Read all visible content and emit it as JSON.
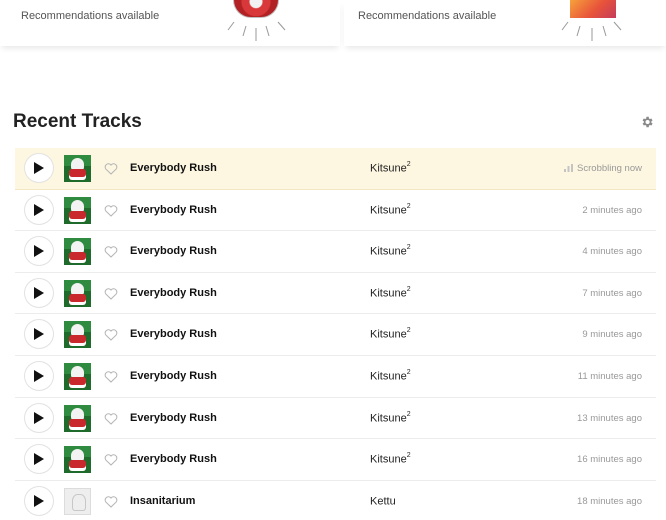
{
  "recommendations": {
    "cards": [
      {
        "text": "Recommendations available"
      },
      {
        "text": "Recommendations available"
      }
    ]
  },
  "section": {
    "title": "Recent Tracks",
    "settings_icon": "gear-icon"
  },
  "tracks": [
    {
      "name": "Everybody Rush",
      "artist": "Kitsune",
      "artist_sup": "2",
      "time": "Scrobbling now",
      "now_playing": true,
      "art": "green"
    },
    {
      "name": "Everybody Rush",
      "artist": "Kitsune",
      "artist_sup": "2",
      "time": "2 minutes ago",
      "art": "green"
    },
    {
      "name": "Everybody Rush",
      "artist": "Kitsune",
      "artist_sup": "2",
      "time": "4 minutes ago",
      "art": "green"
    },
    {
      "name": "Everybody Rush",
      "artist": "Kitsune",
      "artist_sup": "2",
      "time": "7 minutes ago",
      "art": "green"
    },
    {
      "name": "Everybody Rush",
      "artist": "Kitsune",
      "artist_sup": "2",
      "time": "9 minutes ago",
      "art": "green"
    },
    {
      "name": "Everybody Rush",
      "artist": "Kitsune",
      "artist_sup": "2",
      "time": "11 minutes ago",
      "art": "green"
    },
    {
      "name": "Everybody Rush",
      "artist": "Kitsune",
      "artist_sup": "2",
      "time": "13 minutes ago",
      "art": "green"
    },
    {
      "name": "Everybody Rush",
      "artist": "Kitsune",
      "artist_sup": "2",
      "time": "16 minutes ago",
      "art": "green"
    },
    {
      "name": "Insanitarium",
      "artist": "Kettu",
      "artist_sup": "",
      "time": "18 minutes ago",
      "art": "pale"
    }
  ],
  "icons": {
    "play": "play-icon",
    "love": "heart-icon",
    "scrobbling": "scrobbling-bars-icon"
  },
  "colors": {
    "now_playing_bg": "#fdf7e1",
    "muted_text": "#999999"
  }
}
